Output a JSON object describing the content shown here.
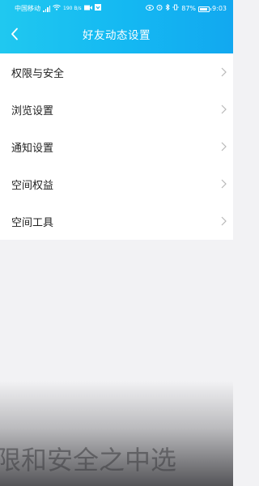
{
  "status_bar": {
    "carrier": "中国移动",
    "speed": "190 B/s",
    "battery": "87%",
    "time": "9:03",
    "battery_level": 0.87
  },
  "header": {
    "title": "好友动态设置"
  },
  "menu": [
    {
      "label": "权限与安全"
    },
    {
      "label": "浏览设置"
    },
    {
      "label": "通知设置"
    },
    {
      "label": "空间权益"
    },
    {
      "label": "空间工具"
    }
  ],
  "overlay": {
    "caption": "限和安全之中选"
  },
  "colors": {
    "header_start": "#20c8f0",
    "header_end": "#12a8f0",
    "background": "#f2f2f4",
    "row_bg": "#ffffff",
    "chevron": "#b8b8b8"
  }
}
